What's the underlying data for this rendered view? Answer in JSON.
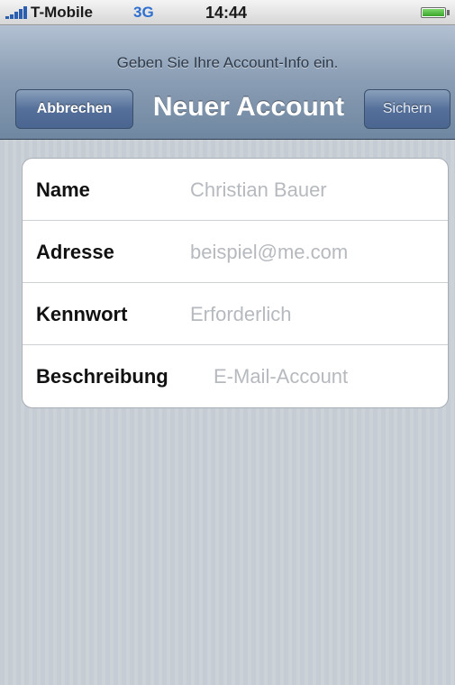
{
  "status_bar": {
    "carrier": "T-Mobile",
    "network": "3G",
    "time": "14:44",
    "battery_level": 1.0,
    "signal_bars": 5
  },
  "nav": {
    "prompt": "Geben Sie Ihre Account-Info ein.",
    "title": "Neuer Account",
    "cancel_label": "Abbrechen",
    "save_label": "Sichern"
  },
  "form": {
    "rows": [
      {
        "label": "Name",
        "placeholder": "Christian Bauer",
        "value": ""
      },
      {
        "label": "Adresse",
        "placeholder": "beispiel@me.com",
        "value": ""
      },
      {
        "label": "Kennwort",
        "placeholder": "Erforderlich",
        "value": ""
      },
      {
        "label": "Beschreibung",
        "placeholder": "E-Mail-Account",
        "value": ""
      }
    ]
  },
  "colors": {
    "nav_button": "#4f6a94",
    "network_text": "#2f6fd0",
    "battery": "#3aa52a"
  }
}
